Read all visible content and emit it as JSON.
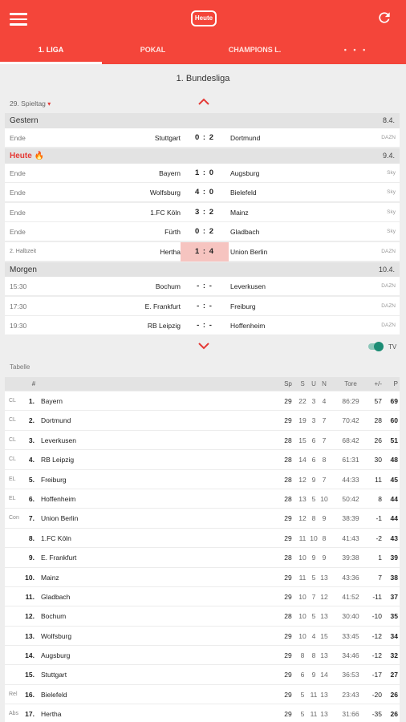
{
  "appbar": {
    "heute_label": "Heute",
    "tabs": [
      {
        "label": "1. LIGA",
        "active": true
      },
      {
        "label": "POKAL",
        "active": false
      },
      {
        "label": "CHAMPIONS L.",
        "active": false
      },
      {
        "label": "• • •",
        "active": false
      }
    ]
  },
  "competition_title": "1. Bundesliga",
  "matchday": {
    "label": "29. Spieltag",
    "arrow": "▾"
  },
  "days": [
    {
      "label": "Gestern",
      "date": "8.4."
    },
    {
      "label": "Heute 🔥",
      "date": "9.4."
    },
    {
      "label": "Morgen",
      "date": "10.4."
    }
  ],
  "matches": [
    {
      "status": "Ende",
      "home": "Stuttgart",
      "score": "0 : 2",
      "away": "Dortmund",
      "tv": "DAZN"
    },
    {
      "status": "Ende",
      "home": "Bayern",
      "score": "1 : 0",
      "away": "Augsburg",
      "tv": "Sky"
    },
    {
      "status": "Ende",
      "home": "Wolfsburg",
      "score": "4 : 0",
      "away": "Bielefeld",
      "tv": "Sky"
    },
    {
      "status": "Ende",
      "home": "1.FC Köln",
      "score": "3 : 2",
      "away": "Mainz",
      "tv": "Sky"
    },
    {
      "status": "Ende",
      "home": "Fürth",
      "score": "0 : 2",
      "away": "Gladbach",
      "tv": "Sky"
    },
    {
      "status": "2. Halbzeit",
      "home": "Hertha",
      "score": "1 : 4",
      "away": "Union Berlin",
      "tv": "DAZN"
    },
    {
      "status": "15:30",
      "home": "Bochum",
      "score": "- : -",
      "away": "Leverkusen",
      "tv": "DAZN"
    },
    {
      "status": "17:30",
      "home": "E. Frankfurt",
      "score": "- : -",
      "away": "Freiburg",
      "tv": "DAZN"
    },
    {
      "status": "19:30",
      "home": "RB Leipzig",
      "score": "- : -",
      "away": "Hoffenheim",
      "tv": "DAZN"
    }
  ],
  "tv_toggle": {
    "label": "TV",
    "on": true
  },
  "table": {
    "section_label": "Tabelle",
    "headers": {
      "pos": "#",
      "sp": "Sp",
      "s": "S",
      "u": "U",
      "n": "N",
      "tore": "Tore",
      "diff": "+/-",
      "p": "P"
    },
    "rows": [
      {
        "q": "CL",
        "pos": "1.",
        "team": "Bayern",
        "sp": "29",
        "s": "22",
        "u": "3",
        "n": "4",
        "tore": "86:29",
        "diff": "57",
        "p": "69"
      },
      {
        "q": "CL",
        "pos": "2.",
        "team": "Dortmund",
        "sp": "29",
        "s": "19",
        "u": "3",
        "n": "7",
        "tore": "70:42",
        "diff": "28",
        "p": "60"
      },
      {
        "q": "CL",
        "pos": "3.",
        "team": "Leverkusen",
        "sp": "28",
        "s": "15",
        "u": "6",
        "n": "7",
        "tore": "68:42",
        "diff": "26",
        "p": "51"
      },
      {
        "q": "CL",
        "pos": "4.",
        "team": "RB Leipzig",
        "sp": "28",
        "s": "14",
        "u": "6",
        "n": "8",
        "tore": "61:31",
        "diff": "30",
        "p": "48"
      },
      {
        "q": "EL",
        "pos": "5.",
        "team": "Freiburg",
        "sp": "28",
        "s": "12",
        "u": "9",
        "n": "7",
        "tore": "44:33",
        "diff": "11",
        "p": "45"
      },
      {
        "q": "EL",
        "pos": "6.",
        "team": "Hoffenheim",
        "sp": "28",
        "s": "13",
        "u": "5",
        "n": "10",
        "tore": "50:42",
        "diff": "8",
        "p": "44"
      },
      {
        "q": "Con",
        "pos": "7.",
        "team": "Union Berlin",
        "sp": "29",
        "s": "12",
        "u": "8",
        "n": "9",
        "tore": "38:39",
        "diff": "-1",
        "p": "44"
      },
      {
        "q": "",
        "pos": "8.",
        "team": "1.FC Köln",
        "sp": "29",
        "s": "11",
        "u": "10",
        "n": "8",
        "tore": "41:43",
        "diff": "-2",
        "p": "43"
      },
      {
        "q": "",
        "pos": "9.",
        "team": "E. Frankfurt",
        "sp": "28",
        "s": "10",
        "u": "9",
        "n": "9",
        "tore": "39:38",
        "diff": "1",
        "p": "39"
      },
      {
        "q": "",
        "pos": "10.",
        "team": "Mainz",
        "sp": "29",
        "s": "11",
        "u": "5",
        "n": "13",
        "tore": "43:36",
        "diff": "7",
        "p": "38"
      },
      {
        "q": "",
        "pos": "11.",
        "team": "Gladbach",
        "sp": "29",
        "s": "10",
        "u": "7",
        "n": "12",
        "tore": "41:52",
        "diff": "-11",
        "p": "37"
      },
      {
        "q": "",
        "pos": "12.",
        "team": "Bochum",
        "sp": "28",
        "s": "10",
        "u": "5",
        "n": "13",
        "tore": "30:40",
        "diff": "-10",
        "p": "35"
      },
      {
        "q": "",
        "pos": "13.",
        "team": "Wolfsburg",
        "sp": "29",
        "s": "10",
        "u": "4",
        "n": "15",
        "tore": "33:45",
        "diff": "-12",
        "p": "34"
      },
      {
        "q": "",
        "pos": "14.",
        "team": "Augsburg",
        "sp": "29",
        "s": "8",
        "u": "8",
        "n": "13",
        "tore": "34:46",
        "diff": "-12",
        "p": "32"
      },
      {
        "q": "",
        "pos": "15.",
        "team": "Stuttgart",
        "sp": "29",
        "s": "6",
        "u": "9",
        "n": "14",
        "tore": "36:53",
        "diff": "-17",
        "p": "27"
      },
      {
        "q": "Rel",
        "pos": "16.",
        "team": "Bielefeld",
        "sp": "29",
        "s": "5",
        "u": "11",
        "n": "13",
        "tore": "23:43",
        "diff": "-20",
        "p": "26"
      },
      {
        "q": "Abs",
        "pos": "17.",
        "team": "Hertha",
        "sp": "29",
        "s": "5",
        "u": "11",
        "n": "13",
        "tore": "31:66",
        "diff": "-35",
        "p": "26"
      }
    ]
  },
  "colors": {
    "primary": "#f4453a",
    "live_score_bg": "#f6c4c0",
    "toggle": "#1b8c74"
  }
}
